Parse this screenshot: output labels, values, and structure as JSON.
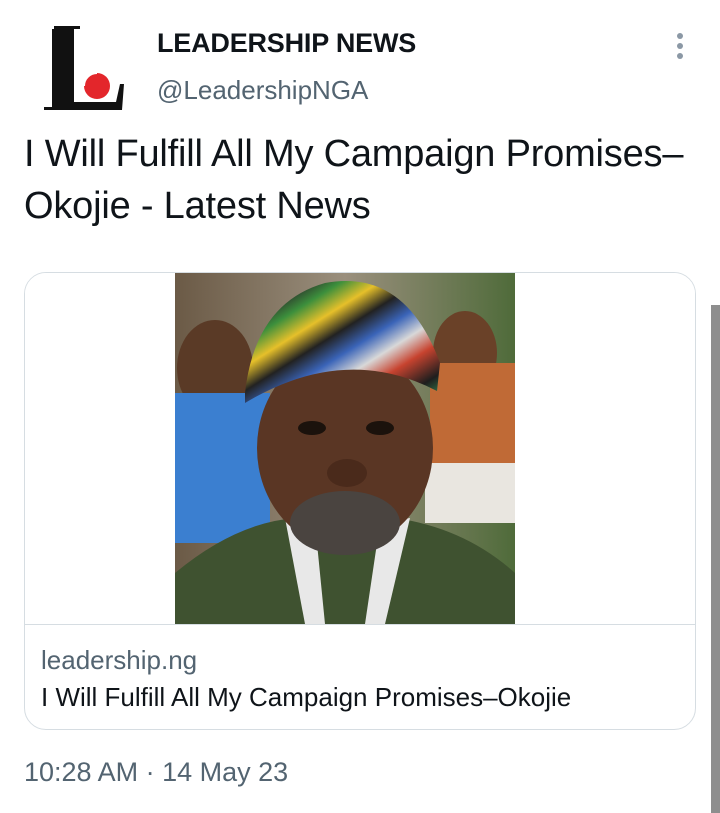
{
  "account": {
    "display_name": "LEADERSHIP NEWS",
    "handle": "@LeadershipNGA",
    "avatar_icon": "leadership-logo-icon",
    "logo_letter": "L"
  },
  "menu": {
    "icon": "more-vertical-icon"
  },
  "tweet": {
    "text": "I Will Fulfill All My Campaign Promises–Okojie - Latest News"
  },
  "card": {
    "image_icon": "news-photo",
    "domain": "leadership.ng",
    "title": "I Will Fulfill All My Campaign Promises–Okojie"
  },
  "meta": {
    "timestamp": "10:28 AM · 14 May 23"
  },
  "colors": {
    "text_primary": "#0f1419",
    "text_secondary": "#536471",
    "logo_red": "#e3262b",
    "card_border": "#d6dde2"
  }
}
